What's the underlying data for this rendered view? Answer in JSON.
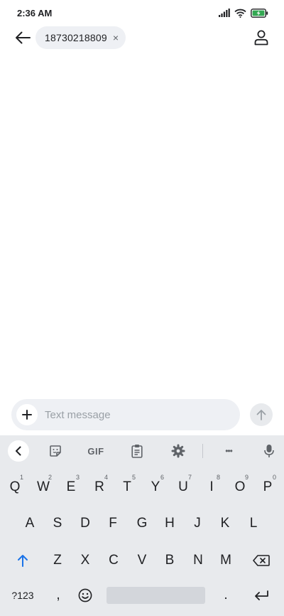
{
  "status_bar": {
    "time": "2:36 AM",
    "icons": [
      "signal-icon",
      "wifi-icon",
      "battery-charging-icon"
    ],
    "battery_color": "#34a853"
  },
  "header": {
    "back_icon": "arrow-left-icon",
    "recipient": "18730218809",
    "chip_close": "×",
    "contact_icon": "person-icon"
  },
  "compose": {
    "placeholder": "Text message",
    "value": "",
    "attach_icon": "plus-icon",
    "send_icon": "arrow-up-icon"
  },
  "keyboard": {
    "toolbar": [
      "chevron-left-icon",
      "sticker-icon",
      "gif-icon",
      "clipboard-icon",
      "gear-icon",
      "more-icon",
      "mic-icon"
    ],
    "gif_label": "GIF",
    "more_label": "•••",
    "row1": [
      {
        "key": "Q",
        "hint": "1"
      },
      {
        "key": "W",
        "hint": "2"
      },
      {
        "key": "E",
        "hint": "3"
      },
      {
        "key": "R",
        "hint": "4"
      },
      {
        "key": "T",
        "hint": "5"
      },
      {
        "key": "Y",
        "hint": "6"
      },
      {
        "key": "U",
        "hint": "7"
      },
      {
        "key": "I",
        "hint": "8"
      },
      {
        "key": "O",
        "hint": "9"
      },
      {
        "key": "P",
        "hint": "0"
      }
    ],
    "row2": [
      "A",
      "S",
      "D",
      "F",
      "G",
      "H",
      "J",
      "K",
      "L"
    ],
    "row3": [
      "Z",
      "X",
      "C",
      "V",
      "B",
      "N",
      "M"
    ],
    "shift_icon": "shift-arrow-icon",
    "shift_color": "#1a73e8",
    "backspace_icon": "backspace-icon",
    "symbols_label": "?123",
    "comma_label": ",",
    "emoji_icon": "emoji-icon",
    "period_label": ".",
    "enter_icon": "enter-icon"
  }
}
